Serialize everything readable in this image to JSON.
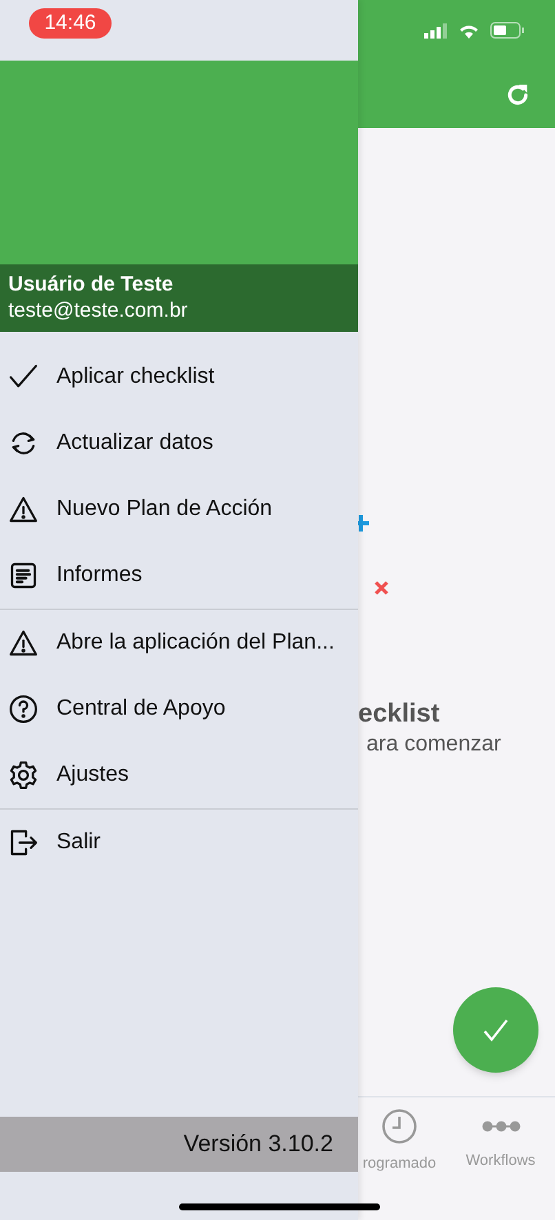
{
  "status_bar": {
    "time": "14:46"
  },
  "background_app": {
    "empty_title": "ecklist",
    "empty_subtitle": "ara comenzar",
    "tabs": [
      {
        "label": "rogramado",
        "kind": "clock"
      },
      {
        "label": "Workflows",
        "kind": "flow"
      }
    ]
  },
  "drawer": {
    "user_name": "Usuário de Teste",
    "user_email": "teste@teste.com.br",
    "sections": [
      {
        "items": [
          {
            "label": "Aplicar checklist",
            "kind": "check"
          },
          {
            "label": "Actualizar datos",
            "kind": "sync"
          },
          {
            "label": "Nuevo Plan de Acción",
            "kind": "warning"
          },
          {
            "label": "Informes",
            "kind": "report"
          }
        ]
      },
      {
        "items": [
          {
            "label": "Abre la aplicación del Plan...",
            "kind": "warning"
          },
          {
            "label": "Central de Apoyo",
            "kind": "help"
          },
          {
            "label": "Ajustes",
            "kind": "gear"
          }
        ]
      },
      {
        "items": [
          {
            "label": "Salir",
            "kind": "logout"
          }
        ]
      }
    ],
    "version": "Versión 3.10.2"
  }
}
